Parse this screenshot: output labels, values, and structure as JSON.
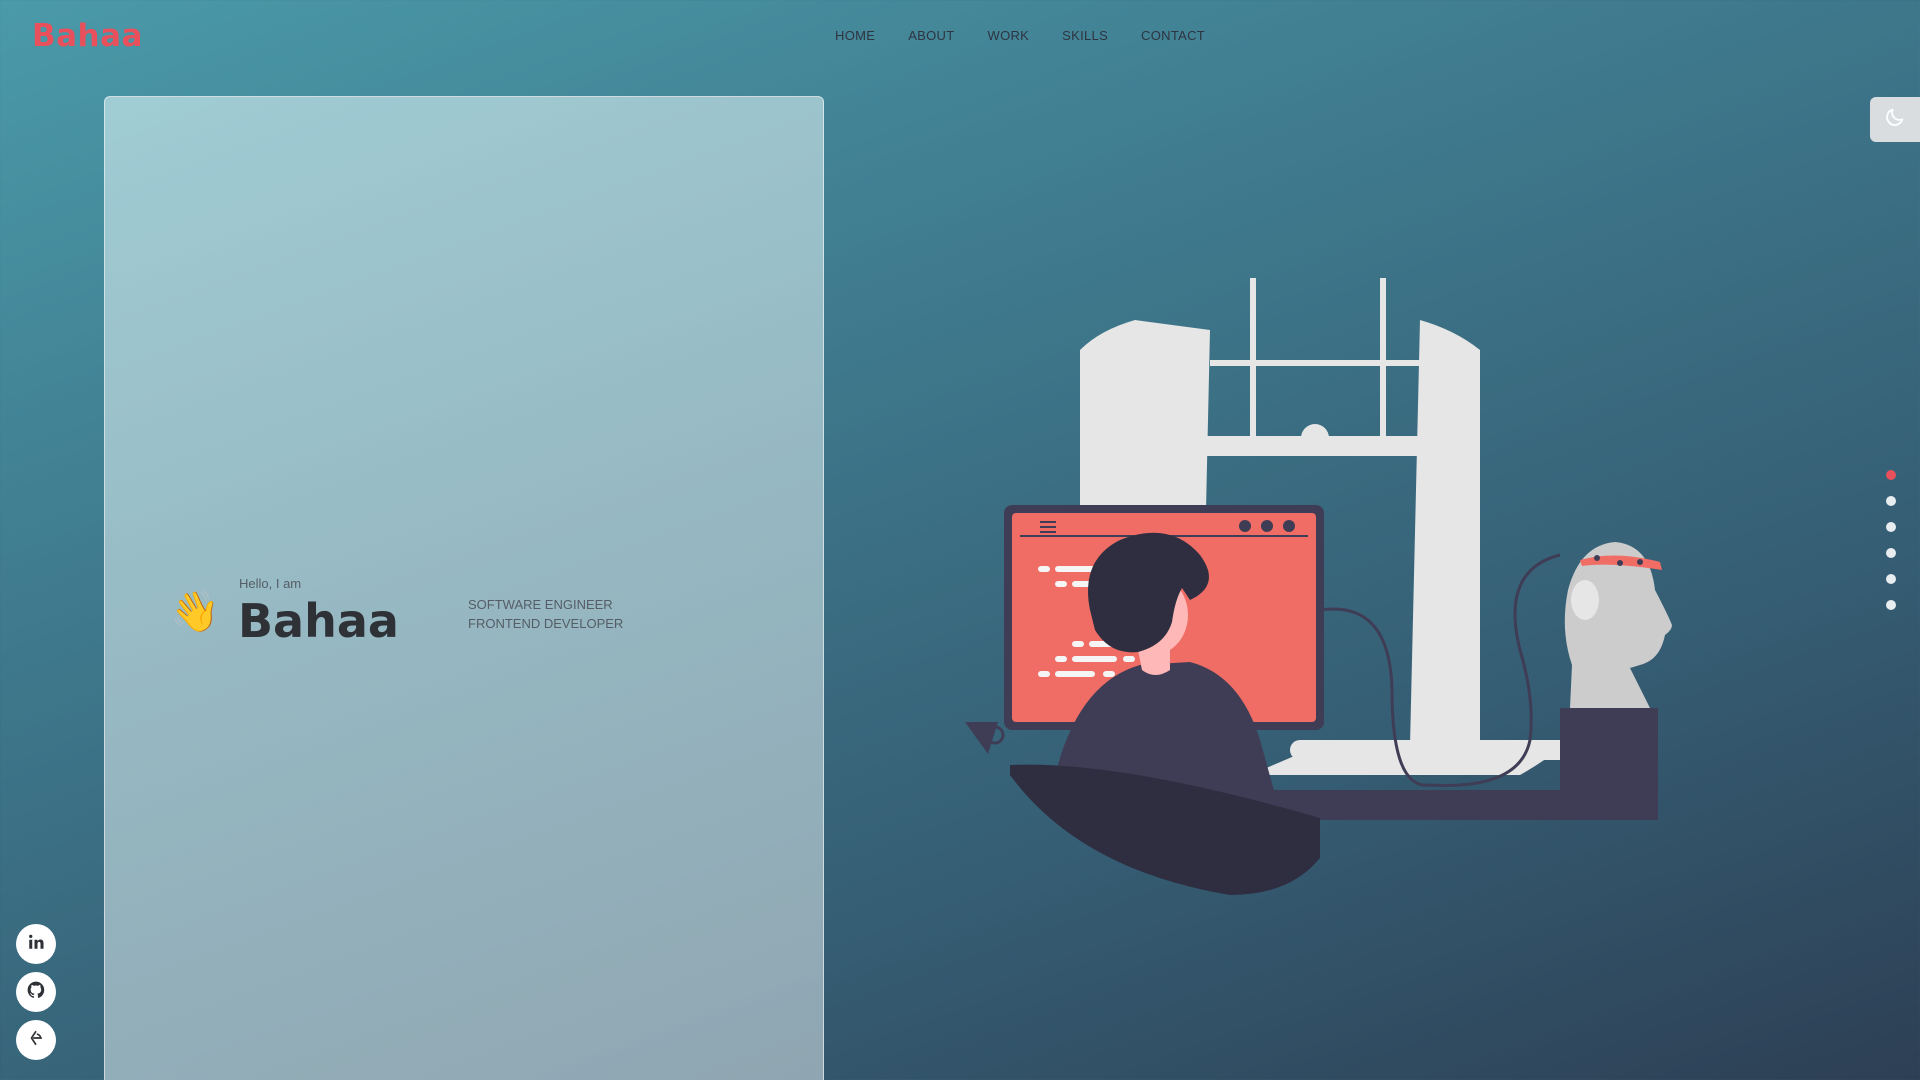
{
  "brand": {
    "logo": "Bahaa",
    "accent": "#e8505b"
  },
  "nav": {
    "items": [
      "HOME",
      "ABOUT",
      "WORK",
      "SKILLS",
      "CONTACT"
    ]
  },
  "hero": {
    "greeting": "Hello, I am",
    "wave_emoji": "👋",
    "name": "Bahaa",
    "roles": [
      "SOFTWARE ENGINEER",
      "FRONTEND DEVELOPER"
    ]
  },
  "theme_toggle": {
    "icon": "moon-icon"
  },
  "section_dots": {
    "count": 6,
    "active_index": 0
  },
  "social": [
    {
      "icon": "linkedin-icon"
    },
    {
      "icon": "github-icon"
    },
    {
      "icon": "freecodecamp-icon"
    }
  ],
  "illustration": {
    "icon": "developer-at-computer-illustration"
  }
}
